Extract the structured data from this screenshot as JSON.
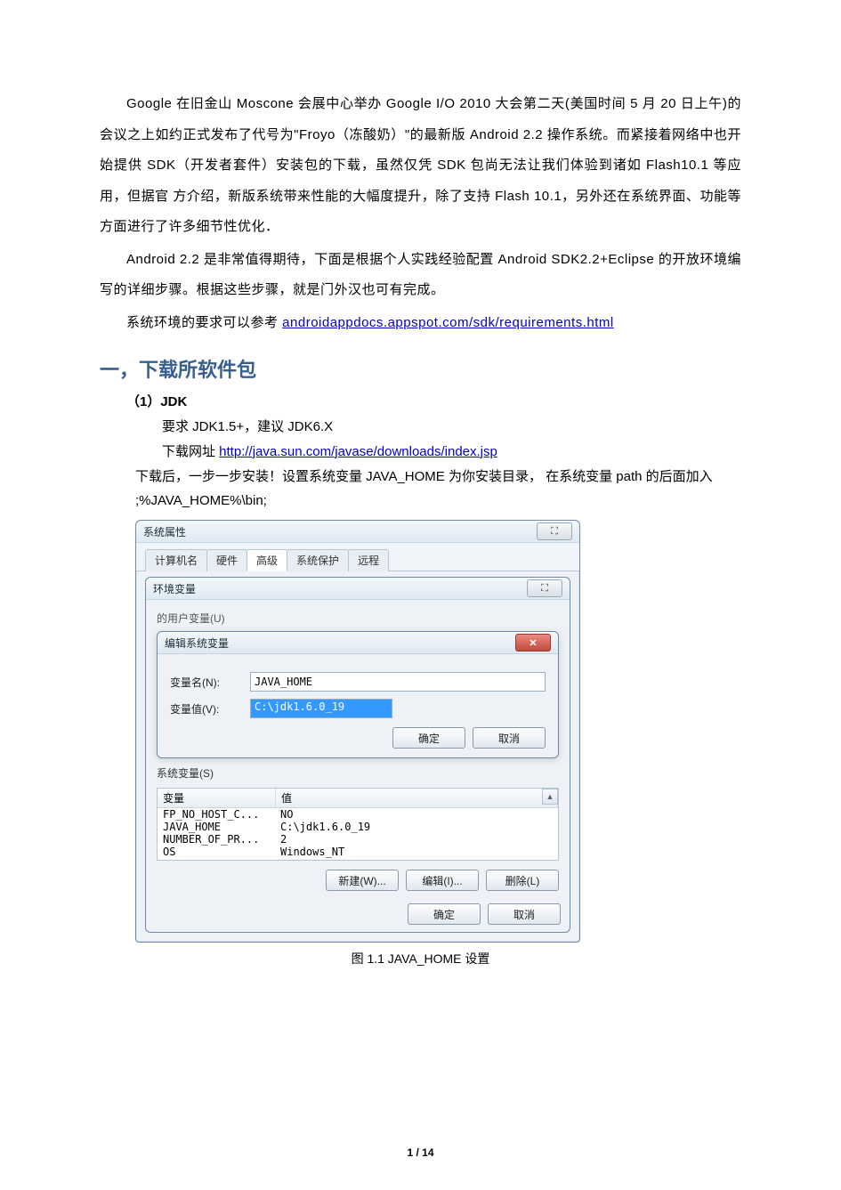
{
  "intro": {
    "p1": "Google 在旧金山 Moscone 会展中心举办 Google I/O 2010 大会第二天(美国时间 5 月 20 日上午)的会议之上如约正式发布了代号为\"Froyo（冻酸奶）\"的最新版 Android 2.2 操作系统。而紧接着网络中也开始提供 SDK（开发者套件）安装包的下载，虽然仅凭 SDK 包尚无法让我们体验到诸如 Flash10.1 等应用，但据官 方介绍，新版系统带来性能的大幅度提升，除了支持 Flash 10.1，另外还在系统界面、功能等方面进行了许多细节性优化．",
    "p2": "Android 2.2 是非常值得期待，下面是根据个人实践经验配置 Android SDK2.2+Eclipse 的开放环境编写的详细步骤。根据这些步骤，就是门外汉也可有完成。",
    "p3_prefix": "系统环境的要求可以参考 ",
    "p3_link": "androidappdocs.appspot.com/sdk/requirements.html"
  },
  "section1": {
    "heading": "一，下载所软件包",
    "item1_title": "（1）JDK",
    "line1": "要求 JDK1.5+，建议 JDK6.X",
    "line2_prefix": "下载网址 ",
    "line2_link": "http://java.sun.com/javase/downloads/index.jsp",
    "line3": "下载后，一步一步安装！设置系统变量 JAVA_HOME 为你安装目录，  在系统变量 path 的后面加入 ;%JAVA_HOME%\\bin;"
  },
  "dialog": {
    "outer_title": "系统属性",
    "tabs": [
      "计算机名",
      "硬件",
      "高级",
      "系统保护",
      "远程"
    ],
    "active_tab": 2,
    "env_title": "环境变量",
    "user_vars_caption": "的用户变量(U)",
    "edit_title": "编辑系统变量",
    "name_label": "变量名(N):",
    "name_value": "JAVA_HOME",
    "value_label": "变量值(V):",
    "value_value": "C:\\jdk1.6.0_19",
    "ok": "确定",
    "cancel": "取消",
    "sysvar_caption": "系统变量(S)",
    "col_name": "变量",
    "col_val": "值",
    "rows": [
      {
        "n": "FP_NO_HOST_C...",
        "v": "NO"
      },
      {
        "n": "JAVA_HOME",
        "v": "C:\\jdk1.6.0_19"
      },
      {
        "n": "NUMBER_OF_PR...",
        "v": "2"
      },
      {
        "n": "OS",
        "v": "Windows_NT"
      }
    ],
    "new_btn": "新建(W)...",
    "edit_btn": "编辑(I)...",
    "del_btn": "删除(L)",
    "close_x": "✕",
    "close_23": "⛶"
  },
  "caption": "图 1.1   JAVA_HOME 设置",
  "page_footer": "1 / 14"
}
